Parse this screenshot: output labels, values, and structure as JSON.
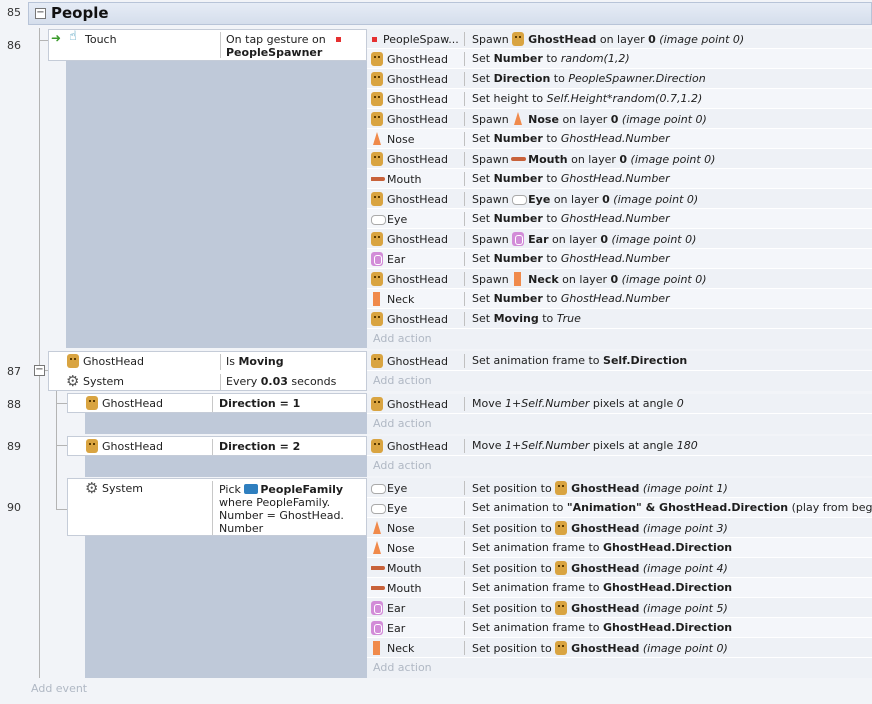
{
  "lines": [
    "85",
    "86",
    "87",
    "88",
    "89",
    "90"
  ],
  "group": {
    "title": "People",
    "toggle": "−"
  },
  "toggle87": "−",
  "events": {
    "e86": {
      "conditions": [
        {
          "object": "Touch",
          "text1": "On tap gesture on",
          "text2": "PeopleSpawner"
        }
      ],
      "actions": [
        {
          "object": "PeopleSpaw...",
          "icon": "spawner",
          "parts": [
            [
              "Spawn ",
              ""
            ],
            [
              "",
              "icon:gh"
            ],
            [
              "GhostHead",
              "b"
            ],
            [
              " on layer ",
              ""
            ],
            [
              "0",
              "b"
            ],
            [
              " (image point 0)",
              "i"
            ]
          ]
        },
        {
          "object": "GhostHead",
          "icon": "gh",
          "parts": [
            [
              "Set ",
              ""
            ],
            [
              "Number",
              "b"
            ],
            [
              " to ",
              ""
            ],
            [
              "random(1,2)",
              "i"
            ]
          ]
        },
        {
          "object": "GhostHead",
          "icon": "gh",
          "parts": [
            [
              "Set ",
              ""
            ],
            [
              "Direction",
              "b"
            ],
            [
              " to ",
              ""
            ],
            [
              "PeopleSpawner.Direction",
              "i"
            ]
          ]
        },
        {
          "object": "GhostHead",
          "icon": "gh",
          "parts": [
            [
              "Set height to ",
              ""
            ],
            [
              "Self.Height*random(0.7,1.2)",
              "i"
            ]
          ]
        },
        {
          "object": "GhostHead",
          "icon": "gh",
          "parts": [
            [
              "Spawn ",
              ""
            ],
            [
              "",
              "icon:nose"
            ],
            [
              "Nose",
              "b"
            ],
            [
              " on layer ",
              ""
            ],
            [
              "0",
              "b"
            ],
            [
              " (image point 0)",
              "i"
            ]
          ]
        },
        {
          "object": "Nose",
          "icon": "nose",
          "parts": [
            [
              "Set ",
              ""
            ],
            [
              "Number",
              "b"
            ],
            [
              " to ",
              ""
            ],
            [
              "GhostHead.Number",
              "i"
            ]
          ]
        },
        {
          "object": "GhostHead",
          "icon": "gh",
          "parts": [
            [
              "Spawn ",
              ""
            ],
            [
              "",
              "icon:mouth"
            ],
            [
              "Mouth",
              "b"
            ],
            [
              " on layer ",
              ""
            ],
            [
              "0",
              "b"
            ],
            [
              " (image point 0)",
              "i"
            ]
          ]
        },
        {
          "object": "Mouth",
          "icon": "mouth",
          "parts": [
            [
              "Set ",
              ""
            ],
            [
              "Number",
              "b"
            ],
            [
              " to ",
              ""
            ],
            [
              "GhostHead.Number",
              "i"
            ]
          ]
        },
        {
          "object": "GhostHead",
          "icon": "gh",
          "parts": [
            [
              "Spawn ",
              ""
            ],
            [
              "",
              "icon:eye"
            ],
            [
              "Eye",
              "b"
            ],
            [
              " on layer ",
              ""
            ],
            [
              "0",
              "b"
            ],
            [
              " (image point 0)",
              "i"
            ]
          ]
        },
        {
          "object": "Eye",
          "icon": "eye",
          "parts": [
            [
              "Set ",
              ""
            ],
            [
              "Number",
              "b"
            ],
            [
              " to ",
              ""
            ],
            [
              "GhostHead.Number",
              "i"
            ]
          ]
        },
        {
          "object": "GhostHead",
          "icon": "gh",
          "parts": [
            [
              "Spawn ",
              ""
            ],
            [
              "",
              "icon:ear"
            ],
            [
              "Ear",
              "b"
            ],
            [
              " on layer ",
              ""
            ],
            [
              "0",
              "b"
            ],
            [
              " (image point 0)",
              "i"
            ]
          ]
        },
        {
          "object": "Ear",
          "icon": "ear",
          "parts": [
            [
              "Set ",
              ""
            ],
            [
              "Number",
              "b"
            ],
            [
              " to ",
              ""
            ],
            [
              "GhostHead.Number",
              "i"
            ]
          ]
        },
        {
          "object": "GhostHead",
          "icon": "gh",
          "parts": [
            [
              "Spawn ",
              ""
            ],
            [
              "",
              "icon:neck"
            ],
            [
              "Neck",
              "b"
            ],
            [
              " on layer ",
              ""
            ],
            [
              "0",
              "b"
            ],
            [
              " (image point 0)",
              "i"
            ]
          ]
        },
        {
          "object": "Neck",
          "icon": "neck",
          "parts": [
            [
              "Set ",
              ""
            ],
            [
              "Number",
              "b"
            ],
            [
              " to ",
              ""
            ],
            [
              "GhostHead.Number",
              "i"
            ]
          ]
        },
        {
          "object": "GhostHead",
          "icon": "gh",
          "parts": [
            [
              "Set ",
              ""
            ],
            [
              "Moving",
              "b"
            ],
            [
              " to ",
              ""
            ],
            [
              "True",
              "i"
            ]
          ]
        }
      ]
    },
    "e87": {
      "conditions": [
        {
          "object": "GhostHead",
          "parts": [
            [
              "Is ",
              ""
            ],
            [
              "Moving",
              "b"
            ]
          ]
        },
        {
          "object": "System",
          "parts": [
            [
              "Every ",
              ""
            ],
            [
              "0.03",
              "b"
            ],
            [
              " seconds",
              ""
            ]
          ]
        }
      ],
      "actions": [
        {
          "object": "GhostHead",
          "icon": "gh",
          "parts": [
            [
              "Set animation frame to ",
              ""
            ],
            [
              "Self.Direction",
              "b"
            ]
          ]
        }
      ]
    },
    "e88": {
      "conditions": [
        {
          "object": "GhostHead",
          "parts": [
            [
              "Direction",
              "b"
            ],
            [
              " = ",
              "b"
            ],
            [
              "1",
              "b"
            ]
          ]
        }
      ],
      "actions": [
        {
          "object": "GhostHead",
          "icon": "gh",
          "parts": [
            [
              "Move ",
              ""
            ],
            [
              "1+Self.Number",
              "i"
            ],
            [
              "  pixels at angle ",
              ""
            ],
            [
              "0",
              "i"
            ]
          ]
        }
      ]
    },
    "e89": {
      "conditions": [
        {
          "object": "GhostHead",
          "parts": [
            [
              "Direction",
              "b"
            ],
            [
              " = ",
              "b"
            ],
            [
              "2",
              "b"
            ]
          ]
        }
      ],
      "actions": [
        {
          "object": "GhostHead",
          "icon": "gh",
          "parts": [
            [
              "Move ",
              ""
            ],
            [
              "1+Self.Number",
              "i"
            ],
            [
              "  pixels at angle ",
              ""
            ],
            [
              "180",
              "i"
            ]
          ]
        }
      ]
    },
    "e90": {
      "conditions": [
        {
          "object": "System",
          "line1a": "Pick ",
          "line1b": "PeopleFamily",
          "line2": "where PeopleFamily.",
          "line3": "Number = GhostHead.",
          "line4": "Number"
        }
      ],
      "actions": [
        {
          "object": "Eye",
          "icon": "eye",
          "parts": [
            [
              "Set position to ",
              ""
            ],
            [
              "",
              "icon:gh"
            ],
            [
              "GhostHead",
              "b"
            ],
            [
              " (image point 1)",
              "i"
            ]
          ]
        },
        {
          "object": "Eye",
          "icon": "eye",
          "parts": [
            [
              "Set animation to ",
              ""
            ],
            [
              "\"Animation\" & GhostHead.Direction",
              "b"
            ],
            [
              " (play from beginning)",
              ""
            ]
          ]
        },
        {
          "object": "Nose",
          "icon": "nose",
          "parts": [
            [
              "Set position to ",
              ""
            ],
            [
              "",
              "icon:gh"
            ],
            [
              "GhostHead",
              "b"
            ],
            [
              " (image point 3)",
              "i"
            ]
          ]
        },
        {
          "object": "Nose",
          "icon": "nose",
          "parts": [
            [
              "Set animation frame to ",
              ""
            ],
            [
              "GhostHead.Direction",
              "b"
            ]
          ]
        },
        {
          "object": "Mouth",
          "icon": "mouth",
          "parts": [
            [
              "Set position to ",
              ""
            ],
            [
              "",
              "icon:gh"
            ],
            [
              "GhostHead",
              "b"
            ],
            [
              " (image point 4)",
              "i"
            ]
          ]
        },
        {
          "object": "Mouth",
          "icon": "mouth",
          "parts": [
            [
              "Set animation frame to ",
              ""
            ],
            [
              "GhostHead.Direction",
              "b"
            ]
          ]
        },
        {
          "object": "Ear",
          "icon": "ear",
          "parts": [
            [
              "Set position to ",
              ""
            ],
            [
              "",
              "icon:gh"
            ],
            [
              "GhostHead",
              "b"
            ],
            [
              " (image point 5)",
              "i"
            ]
          ]
        },
        {
          "object": "Ear",
          "icon": "ear",
          "parts": [
            [
              "Set animation frame to ",
              ""
            ],
            [
              "GhostHead.Direction",
              "b"
            ]
          ]
        },
        {
          "object": "Neck",
          "icon": "neck",
          "parts": [
            [
              "Set position to ",
              ""
            ],
            [
              "",
              "icon:gh"
            ],
            [
              "GhostHead",
              "b"
            ],
            [
              " (image point 0)",
              "i"
            ]
          ]
        }
      ]
    }
  },
  "add_action": "Add action",
  "add_event": "Add event"
}
